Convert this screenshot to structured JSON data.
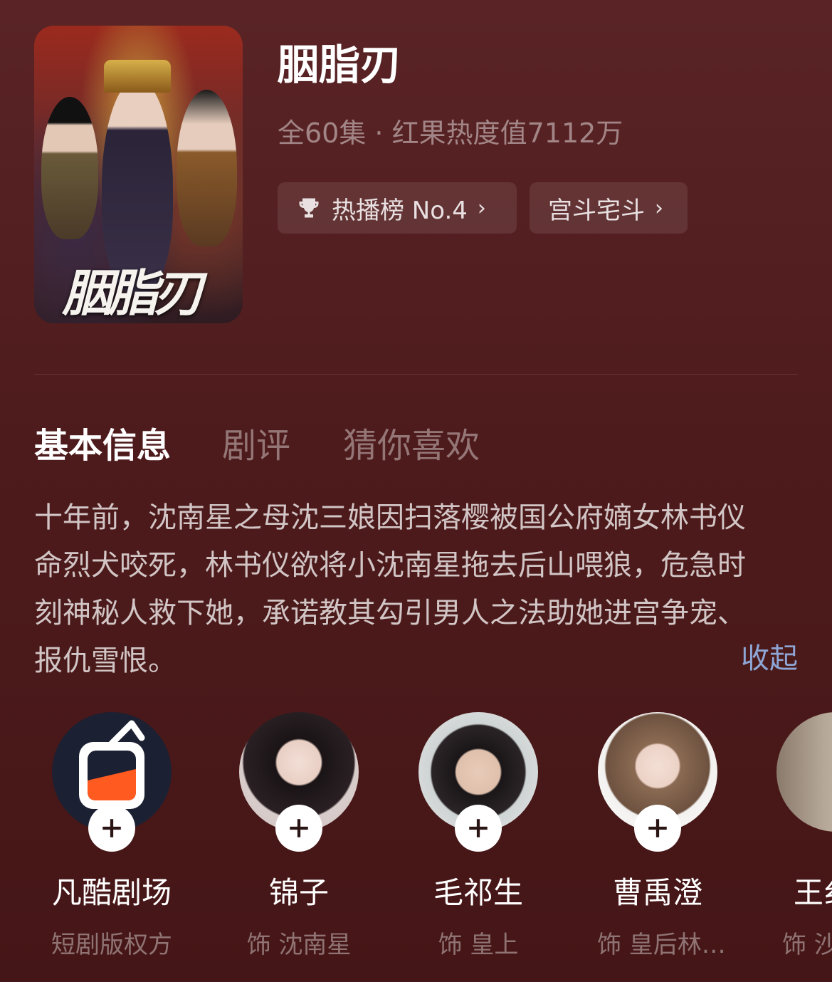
{
  "show": {
    "poster_text": "胭脂刃",
    "title": "胭脂刃",
    "meta": "全60集 · 红果热度值7112万",
    "chips": [
      {
        "label": "热播榜 No.4",
        "icon": "trophy-icon"
      },
      {
        "label": "宫斗宅斗"
      }
    ]
  },
  "tabs": [
    "基本信息",
    "剧评",
    "猜你喜欢"
  ],
  "description": {
    "lines": [
      "十年前，沈南星之母沈三娘因扫落樱被国公府嫡女林书仪",
      "命烈犬咬死，林书仪欲将小沈南星拖去后山喂狼，危急时",
      "刻神秘人救下她，承诺教其勾引男人之法助她进宫争宠、",
      "报仇雪恨。"
    ],
    "collapse_label": "收起"
  },
  "cast": [
    {
      "name": "凡酷剧场",
      "role": "短剧版权方",
      "avatar": "studio-logo"
    },
    {
      "name": "锦子",
      "role": "饰 沈南星",
      "avatar": "actress-photo"
    },
    {
      "name": "毛祁生",
      "role": "饰 皇上",
      "avatar": "actor-photo"
    },
    {
      "name": "曹禹澄",
      "role": "饰 皇后林…",
      "avatar": "actress-photo"
    },
    {
      "name": "王纟",
      "role": "饰 沙",
      "avatar": "actor-photo"
    }
  ],
  "colors": {
    "background": "#4e1b1c",
    "link": "#8ea6d6",
    "logo_orange": "#ff5a1f",
    "logo_navy": "#1c2033"
  }
}
